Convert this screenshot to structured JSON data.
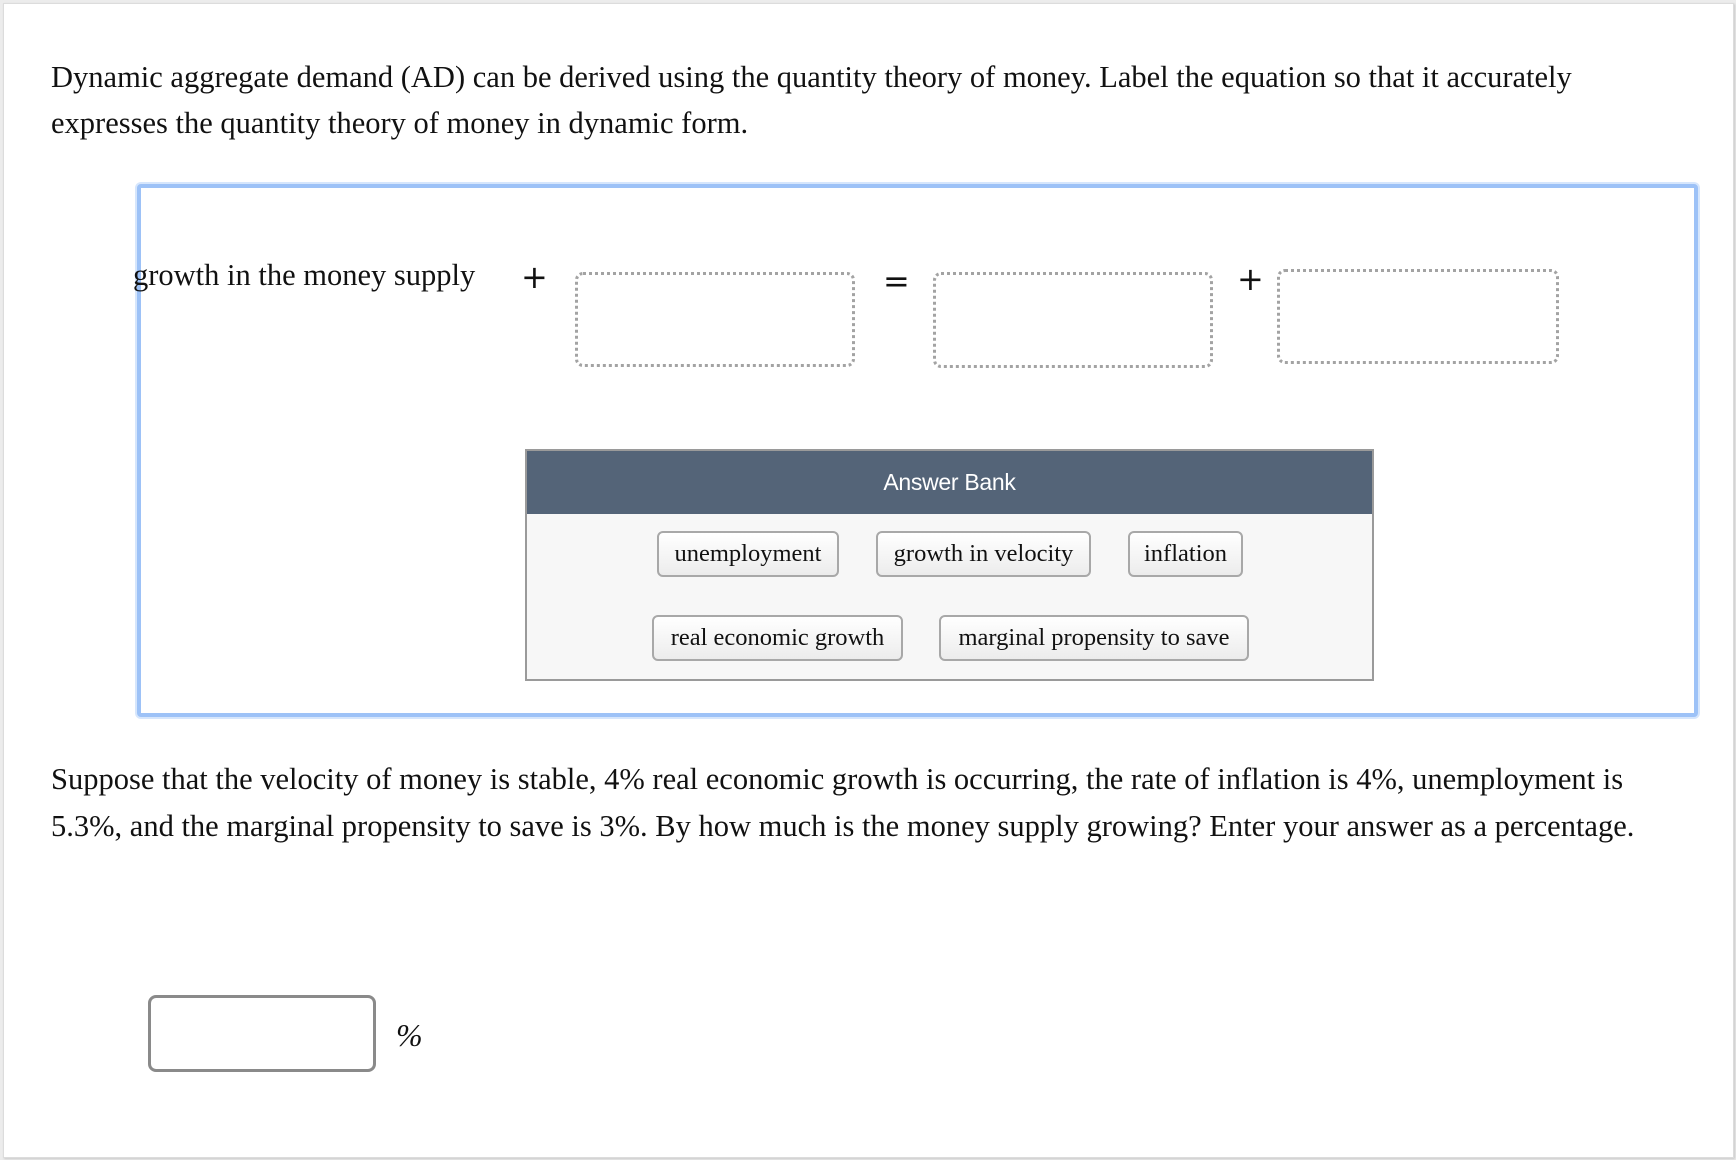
{
  "question1": {
    "text": "Dynamic aggregate demand (AD) can be derived using the quantity theory of money. Label the equation so that it accurately expresses the quantity theory of money in dynamic form."
  },
  "equation": {
    "left_label": "growth in the money supply",
    "op_plus_1": "+",
    "op_equals": "=",
    "op_plus_2": "+",
    "drop_zones": [
      {
        "value": ""
      },
      {
        "value": ""
      },
      {
        "value": ""
      }
    ]
  },
  "answer_bank": {
    "title": "Answer Bank",
    "items": [
      {
        "label": "unemployment"
      },
      {
        "label": "growth in velocity"
      },
      {
        "label": "inflation"
      },
      {
        "label": "real economic growth"
      },
      {
        "label": "marginal propensity to save"
      }
    ]
  },
  "question2": {
    "text": "Suppose that the velocity of money is stable, 4% real economic growth is occurring, the rate of inflation is 4%, unemployment is 5.3%, and the marginal propensity to save is 3%. By how much is the money supply growing? Enter your answer as a percentage."
  },
  "answer": {
    "value": "",
    "unit": "%"
  },
  "colors": {
    "focus_border": "#9dc2f7",
    "bank_header": "#546478"
  }
}
